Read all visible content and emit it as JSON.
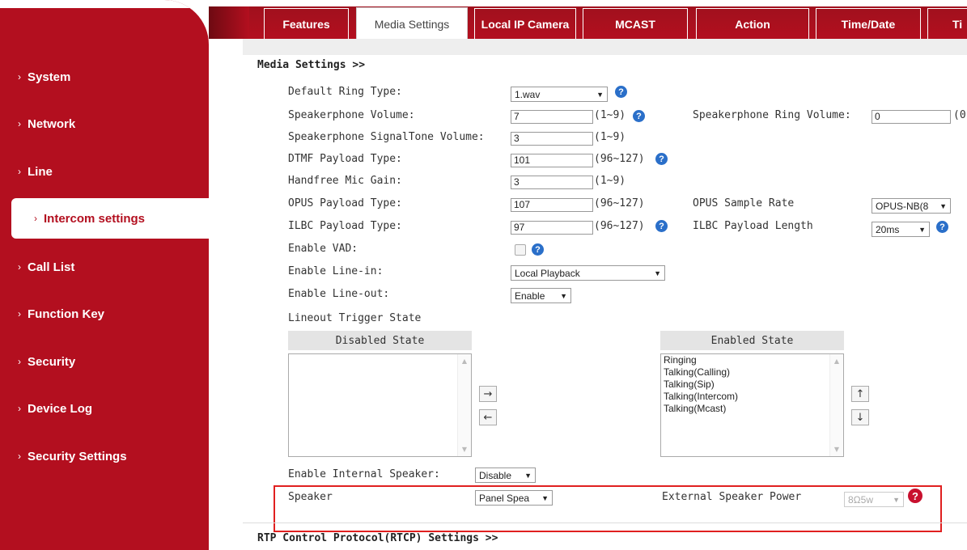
{
  "sidebar": {
    "items": [
      {
        "label": "System"
      },
      {
        "label": "Network"
      },
      {
        "label": "Line"
      },
      {
        "label": "Intercom settings"
      },
      {
        "label": "Call List"
      },
      {
        "label": "Function Key"
      },
      {
        "label": "Security"
      },
      {
        "label": "Device Log"
      },
      {
        "label": "Security Settings"
      }
    ],
    "chevron": "›"
  },
  "tabs": [
    "Features",
    "Media Settings",
    "Local IP Camera",
    "MCAST",
    "Action",
    "Time/Date",
    "Ti"
  ],
  "section_title": "Media Settings >>",
  "fields": {
    "default_ring_type": {
      "label": "Default Ring Type:",
      "value": "1.wav"
    },
    "speakerphone_volume": {
      "label": "Speakerphone Volume:",
      "value": "7",
      "range": "(1~9)"
    },
    "speakerphone_ring_volume": {
      "label": "Speakerphone Ring Volume:",
      "value": "0",
      "range": "(0"
    },
    "signaltone_volume": {
      "label": "Speakerphone SignalTone Volume:",
      "value": "3",
      "range": "(1~9)"
    },
    "dtmf_payload": {
      "label": "DTMF Payload Type:",
      "value": "101",
      "range": "(96~127)"
    },
    "handfree_mic_gain": {
      "label": "Handfree Mic Gain:",
      "value": "3",
      "range": "(1~9)"
    },
    "opus_payload": {
      "label": "OPUS Payload Type:",
      "value": "107",
      "range": "(96~127)"
    },
    "opus_sample_rate": {
      "label": "OPUS Sample Rate",
      "value": "OPUS-NB(8"
    },
    "ilbc_payload": {
      "label": "ILBC Payload Type:",
      "value": "97",
      "range": "(96~127)"
    },
    "ilbc_payload_length": {
      "label": "ILBC Payload Length",
      "value": "20ms"
    },
    "enable_vad": {
      "label": "Enable VAD:"
    },
    "enable_line_in": {
      "label": "Enable Line-in:",
      "value": "Local Playback"
    },
    "enable_line_out": {
      "label": "Enable Line-out:",
      "value": "Enable"
    },
    "lineout_trigger_state": {
      "label": "Lineout Trigger State"
    },
    "enable_internal_speaker": {
      "label": "Enable Internal Speaker:",
      "value": "Disable"
    },
    "speaker": {
      "label": "Speaker",
      "value": "Panel Spea"
    },
    "external_speaker_power": {
      "label": "External Speaker Power",
      "value": "8Ω5w"
    }
  },
  "disabled_state": {
    "header": "Disabled State",
    "items": []
  },
  "enabled_state": {
    "header": "Enabled State",
    "items": [
      "Ringing",
      "Talking(Calling)",
      "Talking(Sip)",
      "Talking(Intercom)",
      "Talking(Mcast)"
    ]
  },
  "buttons": {
    "move_right": "→",
    "move_left": "←",
    "move_up": "↑",
    "move_down": "↓"
  },
  "icons": {
    "help": "?",
    "warning": "?",
    "dropdown": "▼",
    "scroll_up": "▲",
    "scroll_down": "▼"
  },
  "rtcp_title": "RTP Control Protocol(RTCP) Settings >>",
  "colors": {
    "brand_red": "#b30f1f",
    "help_blue": "#2a6fc9",
    "highlight_red": "#e02020"
  }
}
